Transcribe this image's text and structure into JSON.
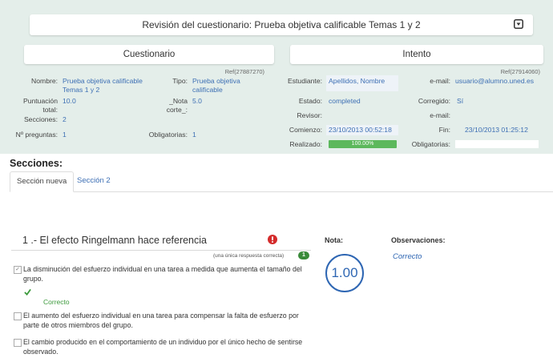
{
  "header": {
    "title": "Revisión del cuestionario: Prueba objetiva calificable Temas 1 y 2",
    "collapse_icon": "collapse-icon"
  },
  "cuestionario": {
    "heading": "Cuestionario",
    "ref": "Ref(27887270)",
    "nombre_label": "Nombre:",
    "nombre_value": "Prueba objetiva calificable Temas 1 y 2",
    "tipo_label": "Tipo:",
    "tipo_value": "Prueba objetiva calificable",
    "puntuacion_label": "Puntuación total:",
    "puntuacion_value": "10.0",
    "nota_corte_label": "_Nota corte_:",
    "nota_corte_value": "5.0",
    "secciones_label": "Secciones:",
    "secciones_value": "2",
    "preguntas_label": "Nº preguntas:",
    "preguntas_value": "1",
    "obligatorias_label": "Obligatorias:",
    "obligatorias_value": "1"
  },
  "intento": {
    "heading": "Intento",
    "ref": "Ref(27914060)",
    "estudiante_label": "Estudiante:",
    "estudiante_value": "Apellidos, Nombre",
    "email_label": "e-mail:",
    "email_value": "usuario@alumno.uned.es",
    "estado_label": "Estado:",
    "estado_value": "completed",
    "corregido_label": "Corregido:",
    "corregido_value": "Sí",
    "revisor_label": "Revisor:",
    "email2_label": "e-mail:",
    "comienzo_label": "Comienzo:",
    "comienzo_value": "23/10/2013 00:52:18",
    "fin_label": "Fin:",
    "fin_value": "23/10/2013 01:25:12",
    "realizado_label": "Realizado:",
    "realizado_value": "100.00%",
    "realizado_fraction": 1.0,
    "obligatorias_label": "Obligatorias:"
  },
  "secciones": {
    "heading": "Secciones:",
    "tabs": [
      {
        "label": "Sección nueva",
        "active": true
      },
      {
        "label": "Sección 2",
        "active": false
      }
    ]
  },
  "question": {
    "title": "1 .-  El efecto Ringelmann hace referencia",
    "response_type": "(una única respuesta correcta)",
    "badge": "1",
    "options": [
      {
        "text": "La disminución del esfuerzo individual en una tarea a medida que aumenta el tamaño del grupo.",
        "checked": true
      },
      {
        "text": "El aumento del esfuerzo individual en una tarea para compensar la falta de esfuerzo por parte de otros miembros del grupo.",
        "checked": false
      },
      {
        "text": "El cambio producido en el comportamiento de un individuo por el único hecho de sentirse observado.",
        "checked": false
      }
    ],
    "correct_label": "Correcto",
    "nota_label": "Nota:",
    "score": "1.00",
    "observaciones_label": "Observaciones:",
    "observaciones_value": "Correcto"
  },
  "colors": {
    "accent": "#3d6fb4",
    "band": "#e4eeea",
    "success": "#5cb85c",
    "score": "#2e66b3"
  }
}
